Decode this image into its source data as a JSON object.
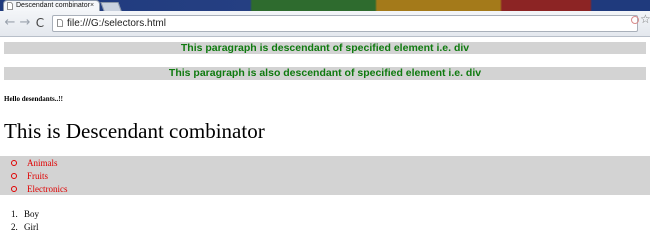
{
  "browser": {
    "tab_title": "Descendant combinator",
    "tab_close": "×",
    "url": "file:///G:/selectors.html",
    "back_glyph": "←",
    "forward_glyph": "→",
    "reload_glyph": "C",
    "star_glyph": "☆"
  },
  "page": {
    "paragraph1": "This paragraph is descendant of specified element i.e. div",
    "paragraph2": "This paragraph is also descendant of specified element i.e. div",
    "hello_text": "Hello desendants..!!",
    "heading": "This is Descendant combinator",
    "unordered_list": [
      "Animals",
      "Fruits",
      "Electronics"
    ],
    "ordered_list": [
      "Boy",
      "Girl"
    ],
    "ordered_numbers": [
      "1.",
      "2."
    ]
  },
  "colors": {
    "paragraph_text": "#0f7a0f",
    "highlight_bg": "#d3d3d3",
    "list_text_red": "#e00000"
  }
}
